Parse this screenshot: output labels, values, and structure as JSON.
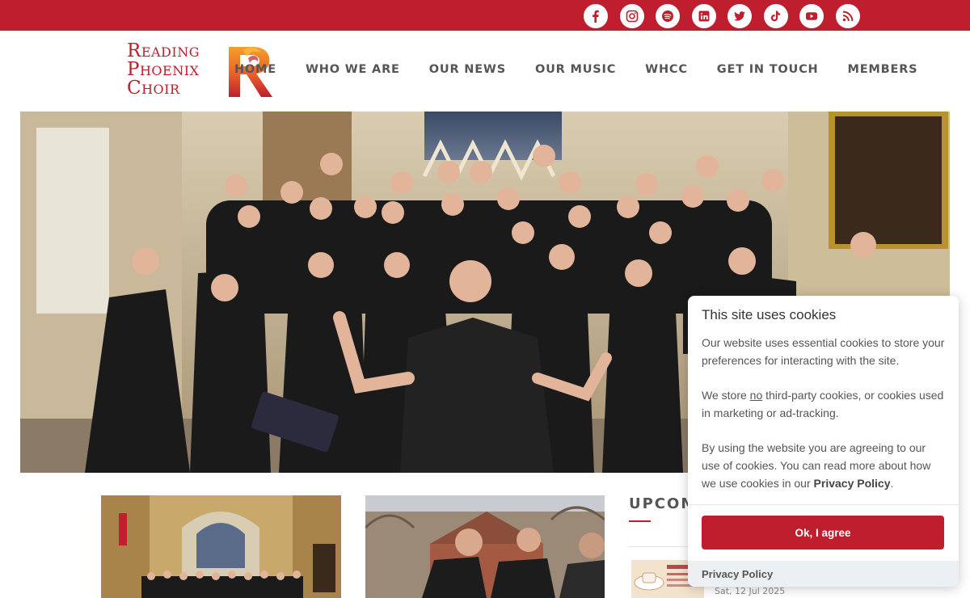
{
  "social": [
    {
      "icon": "facebook-icon"
    },
    {
      "icon": "instagram-icon"
    },
    {
      "icon": "spotify-icon"
    },
    {
      "icon": "linkedin-icon"
    },
    {
      "icon": "twitter-icon"
    },
    {
      "icon": "tiktok-icon"
    },
    {
      "icon": "youtube-icon"
    },
    {
      "icon": "rss-icon"
    }
  ],
  "logo": {
    "line1": "Reading",
    "line2": "Phoenix",
    "line3": "Choir"
  },
  "nav": [
    "HOME",
    "WHO WE ARE",
    "OUR NEWS",
    "OUR MUSIC",
    "WHCC",
    "GET IN TOUCH",
    "MEMBERS"
  ],
  "upcoming": {
    "heading": "UPCOMING",
    "event_date": "Sat, 12 Jul 2025"
  },
  "cookie": {
    "title": "This site uses cookies",
    "p1": "Our website uses essential cookies to store your preferences for interacting with the site.",
    "p2_before": "We store ",
    "p2_emph": "no",
    "p2_after": " third-party cookies, or cookies used in marketing or ad-tracking.",
    "p3_before": "By using the website you are agreeing to our use of cookies. You can read more about how we use cookies in our ",
    "p3_link": "Privacy Policy",
    "p3_after": ".",
    "button": "Ok, I agree",
    "footer_link": "Privacy Policy"
  },
  "colors": {
    "brand": "#be1e2d",
    "nav_text": "#555555"
  }
}
